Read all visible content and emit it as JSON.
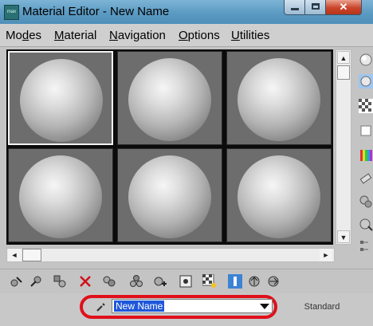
{
  "window": {
    "title": "Material Editor - New Name",
    "app_icon_label": "max",
    "close_glyph": "✕"
  },
  "menu": {
    "items": [
      {
        "label_pre": "Mo",
        "label_ul": "d",
        "label_post": "es"
      },
      {
        "label_pre": "",
        "label_ul": "M",
        "label_post": "aterial"
      },
      {
        "label_pre": "",
        "label_ul": "N",
        "label_post": "avigation"
      },
      {
        "label_pre": "",
        "label_ul": "O",
        "label_post": "ptions"
      },
      {
        "label_pre": "",
        "label_ul": "U",
        "label_post": "tilities"
      }
    ]
  },
  "sample_slots": {
    "count": 6,
    "active_index": 0
  },
  "scroll_glyphs": {
    "up": "▲",
    "down": "▼",
    "left": "◄",
    "right": "►"
  },
  "right_toolbar": {
    "icons": [
      "sample-type-sphere-icon",
      "sample-type-options-icon",
      "background-checker-icon",
      "sample-uv-tiling-icon",
      "video-color-check-icon",
      "make-preview-icon",
      "options-icon",
      "select-by-material-icon",
      "material-map-navigator-icon"
    ]
  },
  "bottom_toolbar": {
    "icons": [
      "get-material-icon",
      "put-material-icon",
      "assign-material-icon",
      "reset-map-icon",
      "make-copy-icon",
      "make-unique-icon",
      "put-to-library-icon",
      "material-id-channel-icon",
      "show-map-in-viewport-icon",
      "show-end-result-icon",
      "go-to-parent-icon",
      "go-forward-to-sibling-icon"
    ]
  },
  "material": {
    "name": "New Name",
    "type": "Standard"
  },
  "colors": {
    "accent_highlight": "#e0101a",
    "selection": "#1e57d9",
    "active_toolbar_button": "#3c83d6"
  }
}
